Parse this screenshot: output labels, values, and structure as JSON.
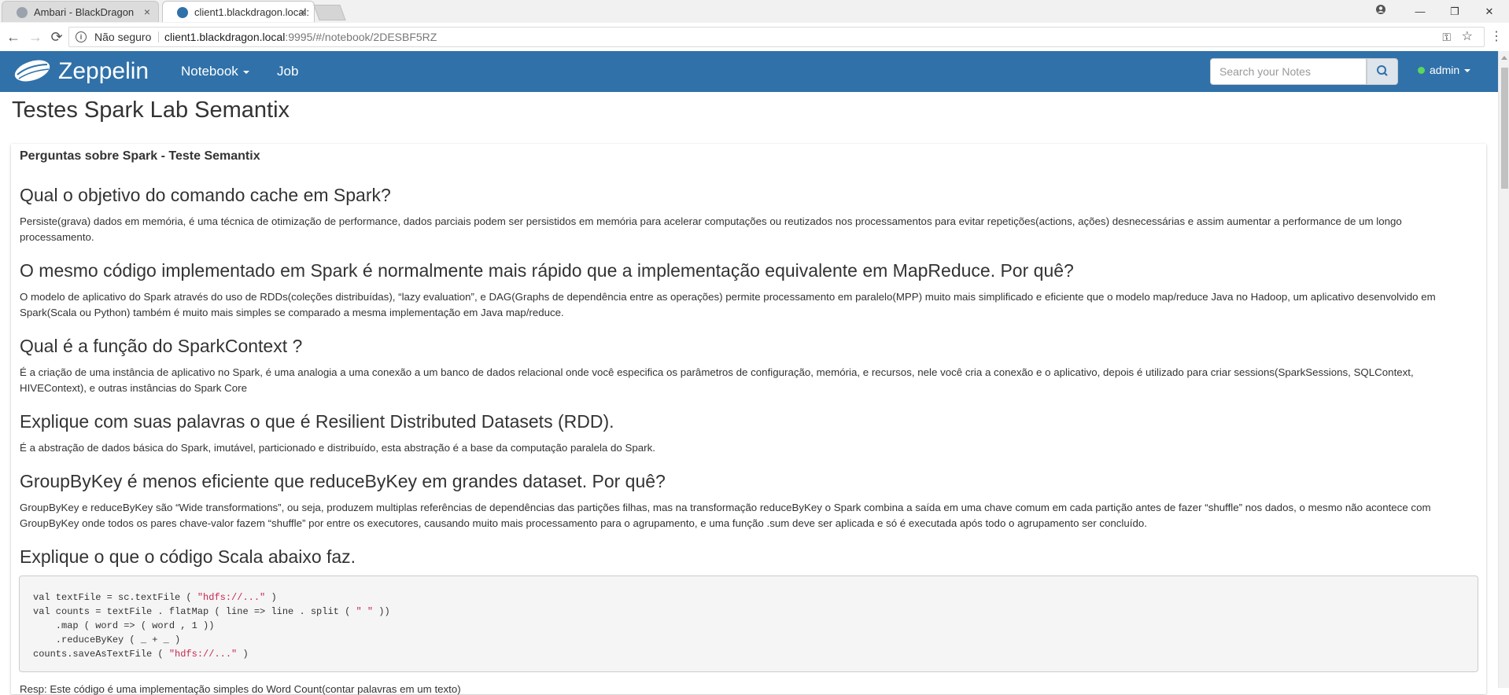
{
  "browser": {
    "tabs": [
      {
        "title": "Ambari - BlackDragon",
        "close": "×"
      },
      {
        "title": "client1.blackdragon.local:",
        "close": "×"
      }
    ],
    "window_controls": {
      "minimize": "—",
      "restore": "❐",
      "close": "✕"
    },
    "nav": {
      "back": "←",
      "forward": "→",
      "reload": "⟳"
    },
    "address": {
      "security_label": "Não seguro",
      "host": "client1.blackdragon.local",
      "path": ":9995/#/notebook/2DESBF5RZ"
    }
  },
  "zeppelin": {
    "brand": "Zeppelin",
    "menu": {
      "notebook": "Notebook",
      "job": "Job"
    },
    "search_placeholder": "Search your Notes",
    "user": "admin",
    "colors": {
      "navbar": "#3071a9",
      "status_online": "#5cd65c"
    }
  },
  "notebook": {
    "title": "Testes Spark Lab Semantix",
    "paragraph": {
      "title": "Perguntas sobre Spark - Teste Semantix",
      "qa": [
        {
          "q": "Qual o objetivo do comando cache em Spark?",
          "a": "Persiste(grava) dados em memória, é uma técnica de otimização de performance, dados parciais podem ser persistidos em memória para acelerar computações ou reutizados nos processamentos para evitar repetições(actions, ações) desnecessárias e assim aumentar a performance de um longo processamento."
        },
        {
          "q": "O mesmo código implementado em Spark é normalmente mais rápido que a implementação equivalente em MapReduce. Por quê?",
          "a": "O modelo de aplicativo do Spark através do uso de RDDs(coleções distribuídas), “lazy evaluation”, e DAG(Graphs de dependência entre as operações) permite processamento em paralelo(MPP) muito mais simplificado e eficiente que o modelo map/reduce Java no Hadoop, um aplicativo desenvolvido em Spark(Scala ou Python) também é muito mais simples se comparado a mesma implementação em Java map/reduce."
        },
        {
          "q": "Qual é a função do SparkContext ?",
          "a": "É a criação de uma instância de aplicativo no Spark, é uma analogia a uma conexão a um banco de dados relacional onde você especifica os parâmetros de configuração, memória, e recursos, nele você cria a conexão e o aplicativo, depois é utilizado para criar sessions(SparkSessions, SQLContext, HIVEContext), e outras instâncias do Spark Core"
        },
        {
          "q": "Explique com suas palavras o que é Resilient Distributed Datasets (RDD).",
          "a": "É a abstração de dados básica do Spark, imutável, particionado e distribuído, esta abstração é a base da computação paralela do Spark."
        },
        {
          "q": "GroupByKey é menos eficiente que reduceByKey em grandes dataset. Por quê?",
          "a": "GroupByKey e reduceByKey são “Wide transformations”, ou seja, produzem multiplas referências de dependências das partições filhas, mas na transformação reduceByKey o Spark combina a saída em uma chave comum em cada partição antes de fazer “shuffle” nos dados, o mesmo não acontece com GroupByKey onde todos os pares chave-valor fazem “shuffle” por entre os executores, causando muito mais processamento para o agrupamento, e uma função .sum deve ser aplicada e só é executada após todo o agrupamento ser concluído."
        },
        {
          "q": "Explique o que o código Scala abaixo faz.",
          "a": ""
        }
      ],
      "code": {
        "line1_a": "val textFile = sc.textFile ( ",
        "line1_s": "\"hdfs://...\"",
        "line1_b": " )",
        "line2_a": "val counts = textFile . flatMap ( line => line . split ( ",
        "line2_s": "\" \"",
        "line2_b": " ))",
        "line3": "    .map ( word => ( word , 1 ))",
        "line4": "    .reduceByKey ( _ + _ )",
        "line5_a": "counts.saveAsTextFile ( ",
        "line5_s": "\"hdfs://...\"",
        "line5_b": " )"
      },
      "cut_line": "Resp: Este código é uma implementação simples do Word Count(contar palavras em um texto)"
    }
  }
}
